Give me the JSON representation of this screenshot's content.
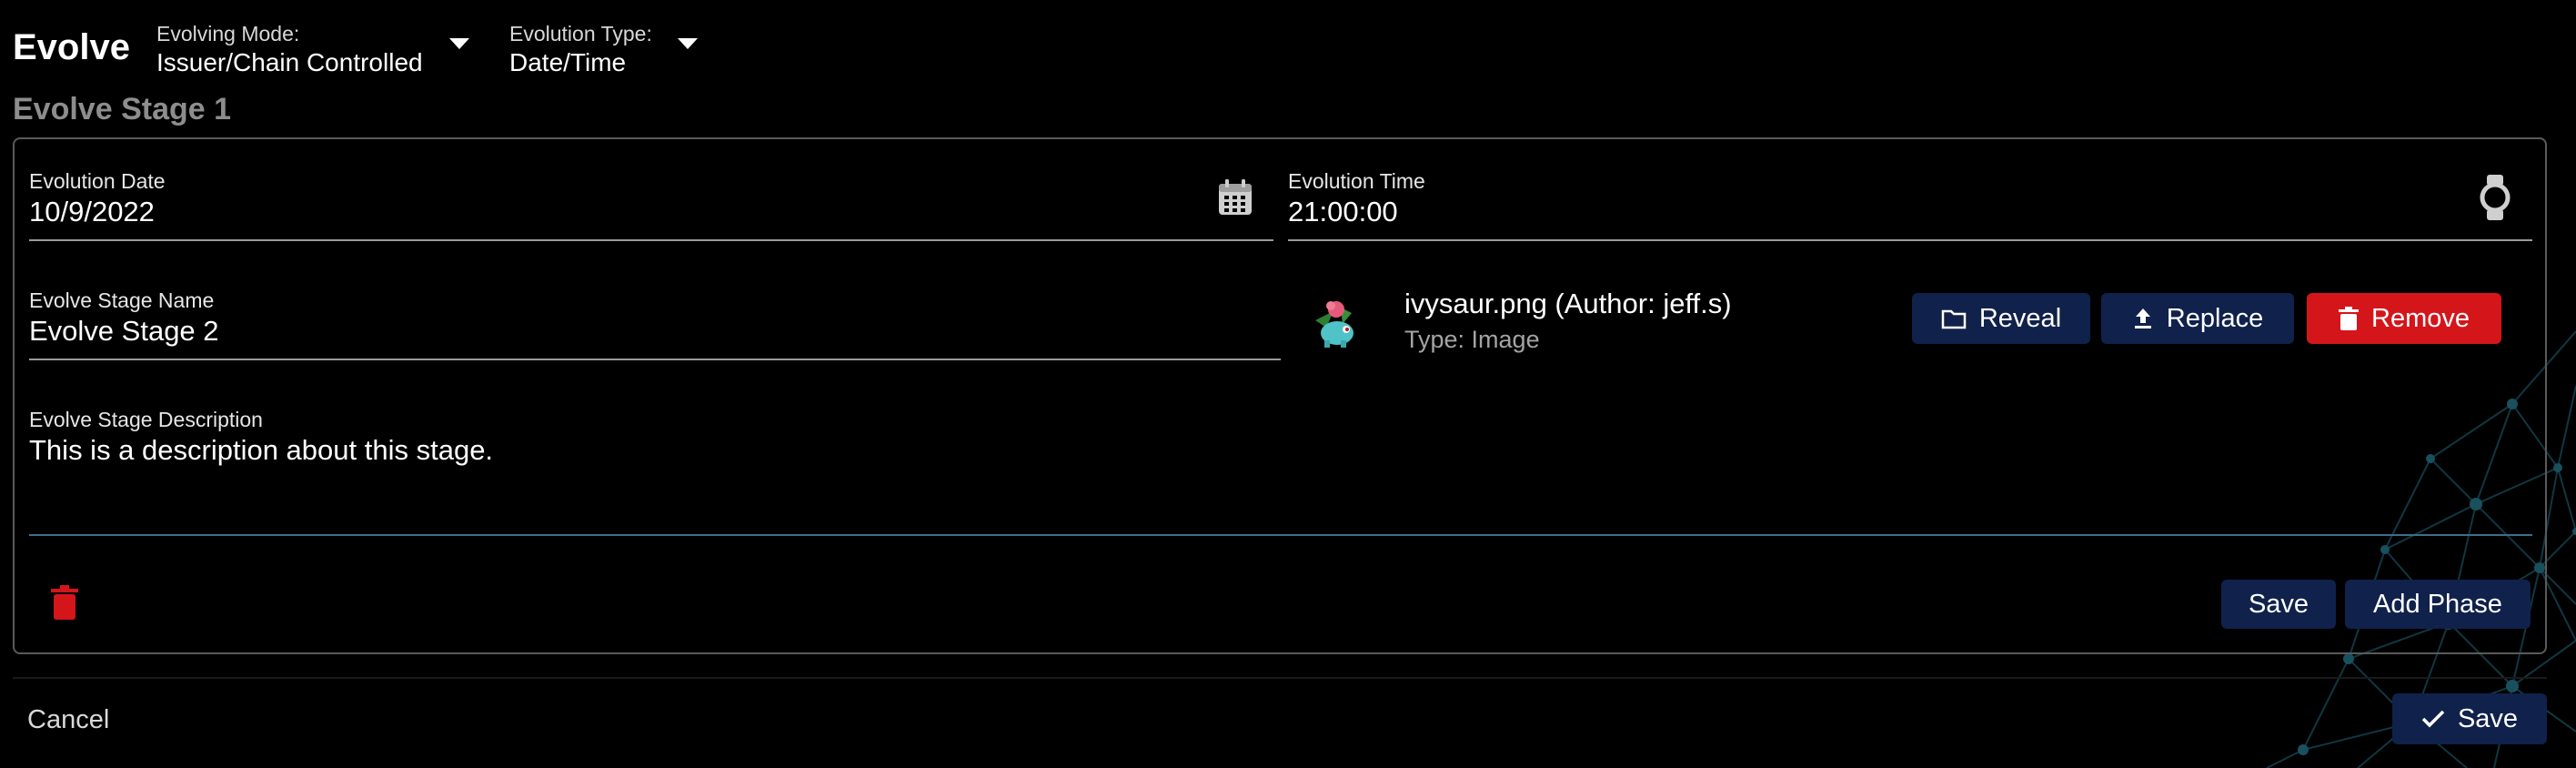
{
  "header": {
    "title": "Evolve",
    "evolving_mode": {
      "caption": "Evolving Mode:",
      "value": "Issuer/Chain Controlled"
    },
    "evolution_type": {
      "caption": "Evolution Type:",
      "value": "Date/Time"
    }
  },
  "stage": {
    "heading": "Evolve Stage 1",
    "evolution_date": {
      "label": "Evolution Date",
      "value": "10/9/2022"
    },
    "evolution_time": {
      "label": "Evolution Time",
      "value": "21:00:00"
    },
    "stage_name": {
      "label": "Evolve Stage Name",
      "value": "Evolve Stage 2"
    },
    "stage_description": {
      "label": "Evolve Stage Description",
      "value": "This is a description about this stage."
    },
    "file": {
      "name": "ivysaur.png (Author: jeff.s)",
      "type": "Type: Image",
      "actions": {
        "reveal": "Reveal",
        "replace": "Replace",
        "remove": "Remove"
      }
    },
    "save_label": "Save",
    "add_phase_label": "Add Phase"
  },
  "footer": {
    "cancel_label": "Cancel",
    "save_label": "Save"
  },
  "colors": {
    "background": "#000000",
    "navy_button": "#10214b",
    "danger": "#d4161b",
    "muted_text": "#8d8d8d"
  },
  "icons": [
    "calendar-icon",
    "watch-icon",
    "folder-icon",
    "upload-icon",
    "trash-icon",
    "check-icon",
    "caret-down-icon"
  ]
}
